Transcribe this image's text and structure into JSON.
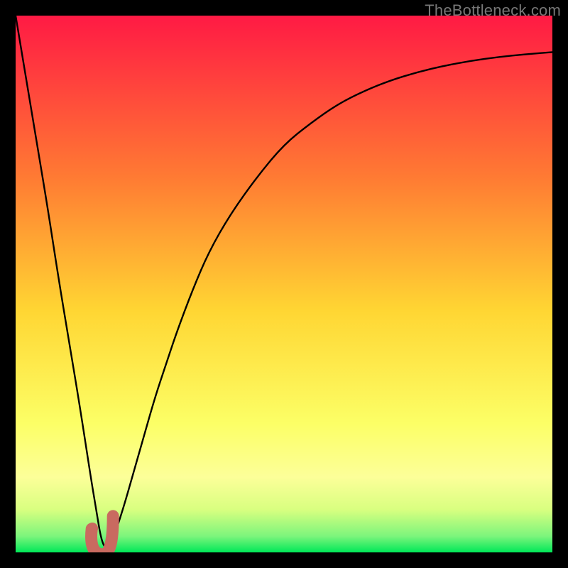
{
  "watermark": "TheBottleneck.com",
  "colors": {
    "frame": "#000000",
    "gradient_top": "#ff1a44",
    "gradient_mid1": "#ff7a33",
    "gradient_mid2": "#ffd633",
    "gradient_mid3": "#fcff66",
    "gradient_mid4": "#d9ff80",
    "gradient_bottom": "#00e858",
    "curve": "#000000",
    "marker_stroke": "#c96a60",
    "marker_fill": "#c96a60"
  },
  "chart_data": {
    "type": "line",
    "title": "",
    "xlabel": "",
    "ylabel": "",
    "xrange": [
      0,
      100
    ],
    "yrange": [
      0,
      100
    ],
    "series": [
      {
        "name": "bottleneck-curve",
        "x": [
          0,
          2,
          4,
          6,
          8,
          10,
          12,
          14,
          15,
          16,
          17,
          18,
          20,
          22,
          24,
          26,
          28,
          30,
          33,
          36,
          40,
          45,
          50,
          55,
          60,
          65,
          70,
          75,
          80,
          85,
          90,
          95,
          100
        ],
        "y": [
          100,
          88,
          76,
          64,
          51,
          39,
          27,
          14,
          8,
          2,
          0.5,
          2,
          8,
          15,
          22,
          29,
          35,
          41,
          49,
          56,
          63,
          70,
          76,
          80,
          83.5,
          86,
          88,
          89.5,
          90.7,
          91.6,
          92.3,
          92.8,
          93.2
        ]
      }
    ],
    "marker": {
      "name": "optimal-point",
      "shape": "J-hook",
      "x": 15.5,
      "y": 2,
      "dot": {
        "x": 14.3,
        "y": 4.5
      }
    },
    "gradient_stops_pct": [
      0,
      30,
      55,
      76,
      86,
      92,
      97,
      100
    ]
  }
}
